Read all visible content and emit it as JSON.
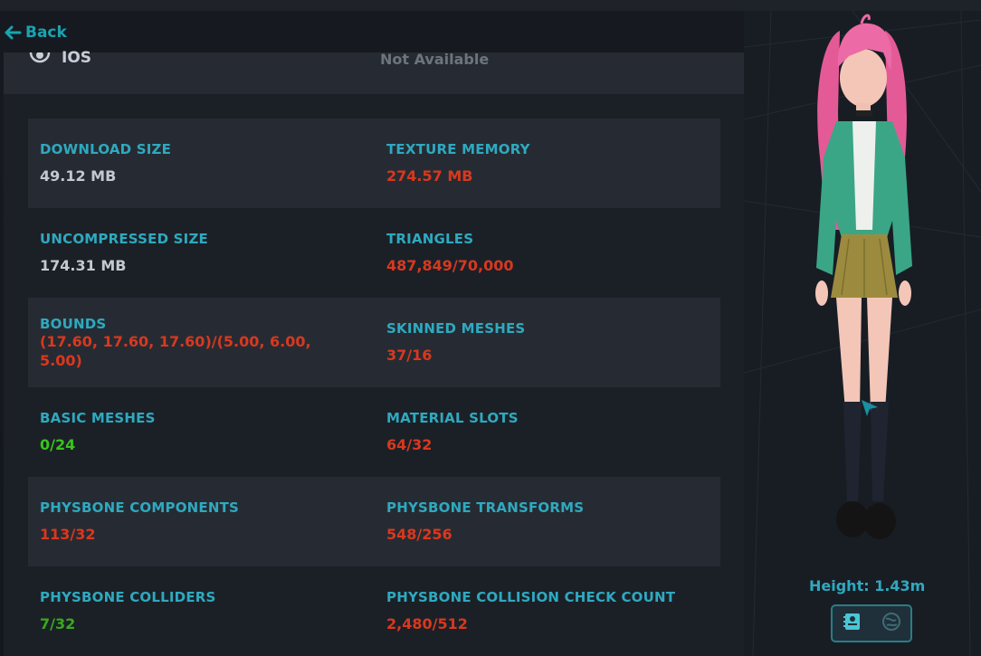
{
  "nav": {
    "back_label": "Back"
  },
  "platform": {
    "name": "IOS",
    "status": "Not Available",
    "icon": "apple-logo-icon"
  },
  "stats": [
    {
      "left": {
        "label": "DOWNLOAD SIZE",
        "value": "49.12 MB",
        "color": "#c4c8cf"
      },
      "right": {
        "label": "TEXTURE MEMORY",
        "value": "274.57 MB",
        "color": "#d9381e"
      }
    },
    {
      "left": {
        "label": "UNCOMPRESSED SIZE",
        "value": "174.31 MB",
        "color": "#c4c8cf"
      },
      "right": {
        "label": "TRIANGLES",
        "value": "487,849/70,000",
        "color": "#d9381e"
      }
    },
    {
      "left": {
        "label": "BOUNDS",
        "value": "(17.60, 17.60, 17.60)/(5.00, 6.00, 5.00)",
        "color": "#d9381e"
      },
      "right": {
        "label": "SKINNED MESHES",
        "value": "37/16",
        "color": "#d9381e"
      }
    },
    {
      "left": {
        "label": "BASIC MESHES",
        "value": "0/24",
        "color": "#39c41a"
      },
      "right": {
        "label": "MATERIAL SLOTS",
        "value": "64/32",
        "color": "#d9381e"
      }
    },
    {
      "left": {
        "label": "PHYSBONE COMPONENTS",
        "value": "113/32",
        "color": "#d9381e"
      },
      "right": {
        "label": "PHYSBONE TRANSFORMS",
        "value": "548/256",
        "color": "#d9381e"
      }
    },
    {
      "left": {
        "label": "PHYSBONE COLLIDERS",
        "value": "7/32",
        "color": "#3aa81e"
      },
      "right": {
        "label": "PHYSBONE COLLISION CHECK COUNT",
        "value": "2,480/512",
        "color": "#d9381e"
      }
    }
  ],
  "preview": {
    "height_text": "Height: 1.43m",
    "toggle_icons": [
      "avatar-card-icon",
      "globe-icon"
    ]
  },
  "colors": {
    "accent": "#2fa9bf",
    "over_limit": "#d9381e",
    "within_limit": "#39c41a",
    "neutral": "#c4c8cf"
  }
}
